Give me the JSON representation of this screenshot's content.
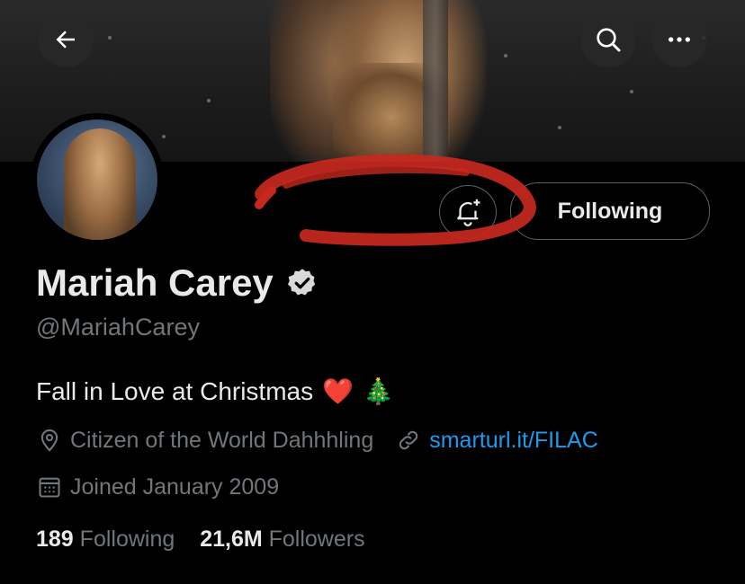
{
  "header": {
    "back_icon": "arrow-left-icon",
    "search_icon": "search-icon",
    "more_icon": "more-horizontal-icon"
  },
  "profile": {
    "name": "Mariah Carey",
    "verified_icon": "verified-badge-icon",
    "handle": "@MariahCarey",
    "bio": "Fall in Love at Christmas",
    "bio_emoji_heart": "❤️",
    "bio_emoji_tree": "🎄",
    "location": "Citizen of the World Dahhhling",
    "website": "smarturl.it/FILAC",
    "joined": "Joined January 2009",
    "following_count": "189",
    "following_label": "Following",
    "followers_count": "21,6M",
    "followers_label": "Followers"
  },
  "actions": {
    "notify_icon": "bell-plus-icon",
    "following_button": "Following"
  },
  "colors": {
    "background": "#000000",
    "text_primary": "#e7e9ea",
    "text_secondary": "#71767b",
    "link": "#1d9bf0",
    "scribble": "#c7281e"
  }
}
